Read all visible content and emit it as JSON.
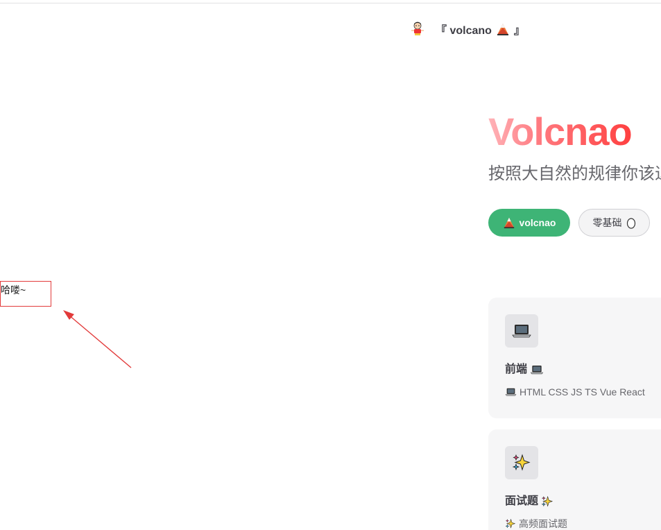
{
  "nav": {
    "logo_icon": "shin-chan-avatar-icon",
    "title_prefix": "『 volcano",
    "title_icon": "volcano-icon",
    "title_suffix": "』"
  },
  "hero": {
    "name": "Volcnao",
    "tagline": "按照大自然的规律你该退"
  },
  "actions": [
    {
      "icon": "volcano-icon",
      "text": "volcnao",
      "theme": "brand",
      "color": "#3eb476"
    },
    {
      "text": "零基础",
      "icon": "egg-icon",
      "theme": "alt"
    }
  ],
  "annotation": {
    "text": "哈喽~",
    "border_color": "#e23a3a",
    "arrow_color": "#e23a3a"
  },
  "features": [
    {
      "icon": "laptop-icon",
      "title": "前端",
      "details": "HTML CSS JS TS Vue React"
    },
    {
      "icon": "sparkles-icon",
      "title": "面试题",
      "details": "高频面试题"
    }
  ],
  "colors": {
    "brand_green": "#3eb476",
    "hero_gradient_start": "#ffb3b8",
    "hero_gradient_end": "#ff4040",
    "text": "#3c3c43",
    "muted": "#67676c",
    "feature_bg": "#f6f6f7"
  }
}
